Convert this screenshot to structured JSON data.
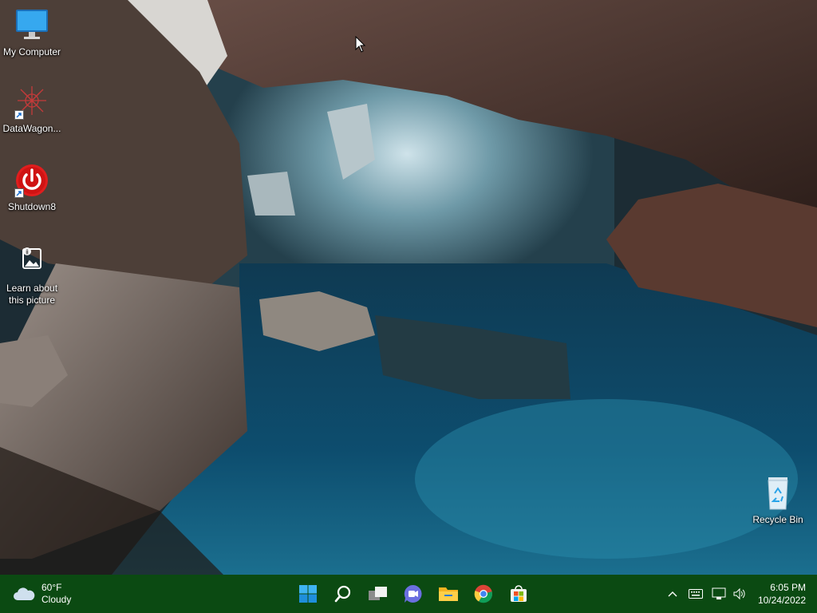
{
  "desktop": {
    "icons": [
      {
        "label": "My Computer"
      },
      {
        "label": "DataWagon..."
      },
      {
        "label": "Shutdown8"
      },
      {
        "label": "Learn about this picture"
      },
      {
        "label": "Recycle Bin"
      }
    ]
  },
  "taskbar": {
    "weather": {
      "temperature": "60°F",
      "condition": "Cloudy"
    },
    "pinned": [
      {
        "name": "start-icon"
      },
      {
        "name": "search-icon"
      },
      {
        "name": "task-view-icon"
      },
      {
        "name": "chat-icon"
      },
      {
        "name": "file-explorer-icon"
      },
      {
        "name": "chrome-icon"
      },
      {
        "name": "microsoft-store-icon"
      }
    ],
    "tray": {
      "time": "6:05 PM",
      "date": "10/24/2022"
    }
  },
  "colors": {
    "taskbar": "#0b4a12",
    "accent": "#2aa3e8"
  }
}
